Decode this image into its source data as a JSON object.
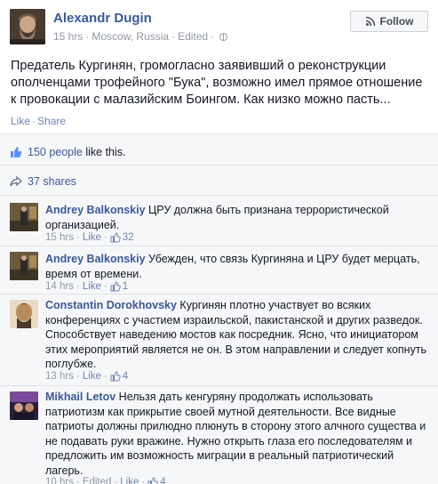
{
  "post": {
    "author": "Alexandr Dugin",
    "time": "15 hrs",
    "location": "Moscow, Russia",
    "edited": "Edited",
    "follow_label": "Follow",
    "text_lines": [
      "Предатель Кургинян, громогласно заявивший о реконструкции",
      "ополченцами трофейного \"Бука\", возможно имел прямое отношение",
      "к провокации с малазийским Боингом. Как низко можно пасть..."
    ],
    "actions": {
      "like": "Like",
      "share": "Share"
    },
    "icons": {
      "globe": "globe-icon",
      "follow": "rss-follow-icon"
    }
  },
  "ufi": {
    "likes_link": "150 people",
    "likes_suffix": " like this.",
    "shares": "37 shares"
  },
  "comments": [
    {
      "name": "Andrey Balkonskiy",
      "lines": [
        "ЦРУ должна быть признана террористической",
        "организацией."
      ],
      "time": "15 hrs",
      "like": "Like",
      "likes": "32"
    },
    {
      "name": "Andrey Balkonskiy",
      "lines": [
        "Убежден, что связь Кургиняна и ЦРУ будет мерцать,",
        "время от времени."
      ],
      "time": "14 hrs",
      "like": "Like",
      "likes": "1"
    },
    {
      "name": "Constantin Dorokhovsky",
      "lines": [
        "Кургинян плотно участвует во всяких",
        "конференциях с участием израильской, пакистанской и других разведок.",
        "Способствует наведению мостов как посредник. Ясно, что инициатором",
        "этих мероприятий является не он. В этом направлении и следует копнуть",
        "поглубже."
      ],
      "time": "13 hrs",
      "like": "Like",
      "likes": "4"
    },
    {
      "name": "Mikhail Letov",
      "lines": [
        "Нельзя дать кенгуряну продолжать использовать",
        "патриотизм как прикрытие своей мутной деятельности. Все видные",
        "патриоты должны прилюдно плюнуть в сторону этого алчного существа и",
        "не подавать руки вражине. Нужно открыть глаза его последователям и",
        "предложить им возможность миграции в реальный патриотический",
        "лагерь."
      ],
      "time": "10 hrs",
      "edited": "Edited",
      "like": "Like",
      "likes": "4"
    }
  ],
  "colors": {
    "link": "#3b5998",
    "meta": "#9197a3",
    "ufi_bg": "#f6f7f9"
  }
}
